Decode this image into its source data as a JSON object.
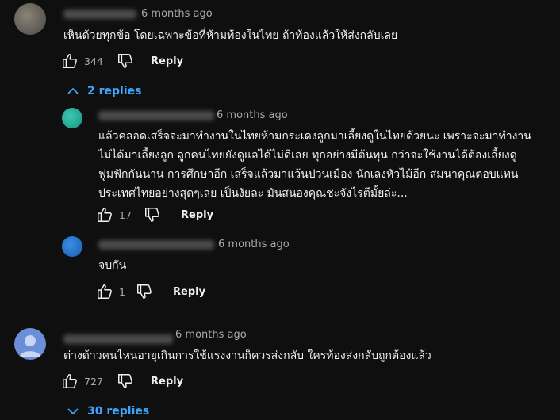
{
  "comments": [
    {
      "time": "6 months ago",
      "text": "เห็นด้วยทุกข้อ  โดยเฉพาะข้อที่ห้ามท้องในไทย ถ้าท้องแล้วให้ส่งกลับเลย",
      "likes": "344",
      "reply_label": "Reply",
      "replies_toggle": "2 replies",
      "replies": [
        {
          "time": "6 months ago",
          "text_lines": [
            "แล้วคลอดเสร็จจะมาทำงานในไทยห้ามกระเดงลูกมาเลี้ยงดูในไทยด้วยนะ เพราะจะมาทำงาน",
            "ไม่ได้มาเลี้ยงลูก ลูกคนไทยยังดูแลได้ไม่ดีเลย ทุกอย่างมีต้นทุน กว่าจะใช้งานได้ต้องเลี้ยงดู",
            "ฟูมฟักกันนาน การศึกษาอีก เสร็จแล้วมาแว้นป่วนเมือง นักเลงหัวไม้อีก สมนาคุณตอบแทน",
            "ประเทศไทยอย่างสุดๆเลย เป็นงัยละ มันสนองคุณชะจังไรตีมั้ยล่ะ..."
          ],
          "likes": "17",
          "reply_label": "Reply"
        },
        {
          "time": "6 months ago",
          "text": "จบกัน",
          "likes": "1",
          "reply_label": "Reply"
        }
      ]
    },
    {
      "time": "6 months ago",
      "text": "ต่างด้าวคนไหนอายุเกินการใช้แรงงานก็ควรส่งกลับ ใครท้องส่งกลับถูกต้องแล้ว",
      "likes": "727",
      "reply_label": "Reply",
      "replies_toggle": "30 replies"
    }
  ],
  "colors": {
    "background": "#0f0f0f",
    "text": "#f1f1f1",
    "meta": "#aaaaaa",
    "link": "#3ea6ff"
  }
}
